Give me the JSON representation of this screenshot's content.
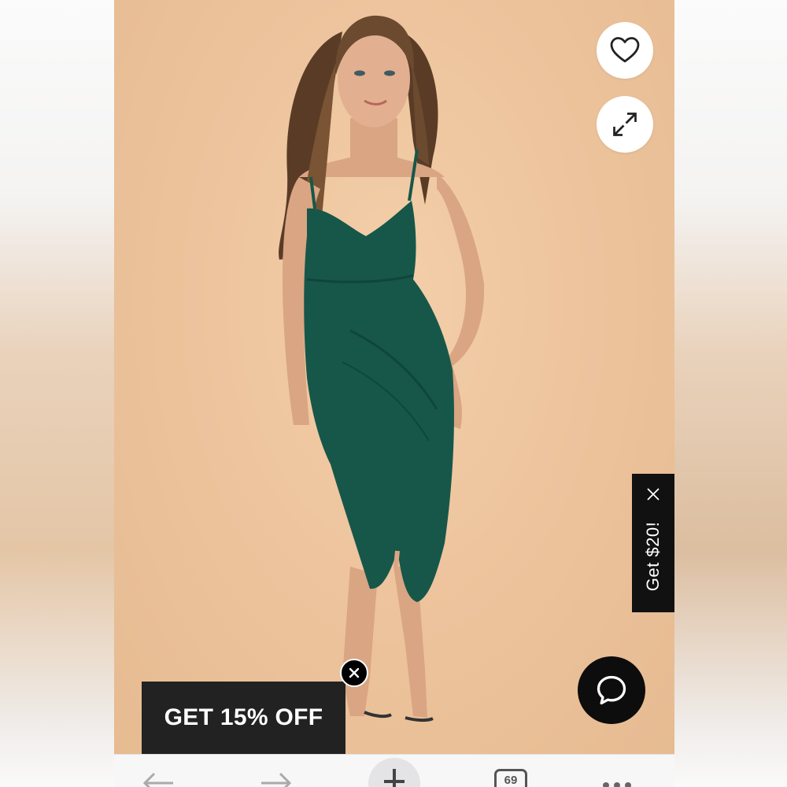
{
  "product": {
    "image_alt": "Model wearing emerald green midi dress",
    "dress_color": "#17574a",
    "background_color": "#edc49d"
  },
  "actions": {
    "favorite_icon": "heart-icon",
    "expand_icon": "expand-icon"
  },
  "promo_tab": {
    "label": "Get $20!",
    "close_icon": "close-icon"
  },
  "discount_banner": {
    "label": "GET 15% OFF",
    "close_icon": "close-circle-icon"
  },
  "chat": {
    "icon": "chat-bubble-icon"
  },
  "browser_toolbar": {
    "back_icon": "arrow-left-icon",
    "forward_icon": "arrow-right-icon",
    "new_tab_icon": "plus-icon",
    "tab_count": "69",
    "more_icon": "more-dots-icon"
  }
}
